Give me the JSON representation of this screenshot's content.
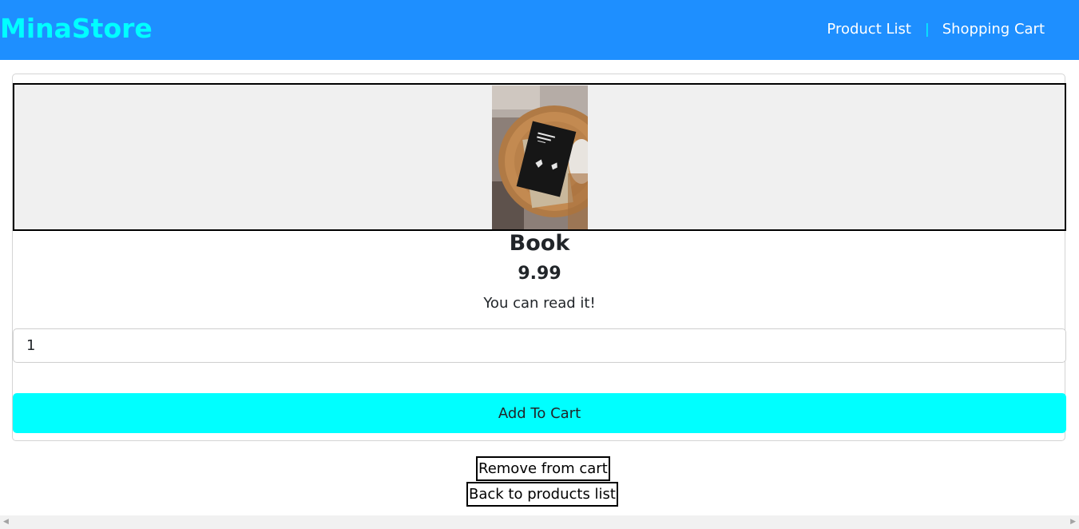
{
  "header": {
    "brand": "MinaStore",
    "nav": {
      "product_list": "Product List",
      "separator": "|",
      "shopping_cart": "Shopping Cart"
    }
  },
  "product": {
    "image_alt": "milk and honey book on a wooden table",
    "name": "Book",
    "price": "9.99",
    "description": "You can read it!",
    "quantity": "1",
    "add_to_cart_label": "Add To Cart"
  },
  "actions": {
    "remove_label": "Remove from cart",
    "back_label": "Back to products list"
  },
  "colors": {
    "header_bg": "#1e8fff",
    "brand": "#00ffff",
    "add_button_bg": "#00ffff",
    "image_bg": "#f0f0f0"
  },
  "icons": {
    "scroll_left": "scroll-left-arrow-icon",
    "scroll_right": "scroll-right-arrow-icon"
  }
}
